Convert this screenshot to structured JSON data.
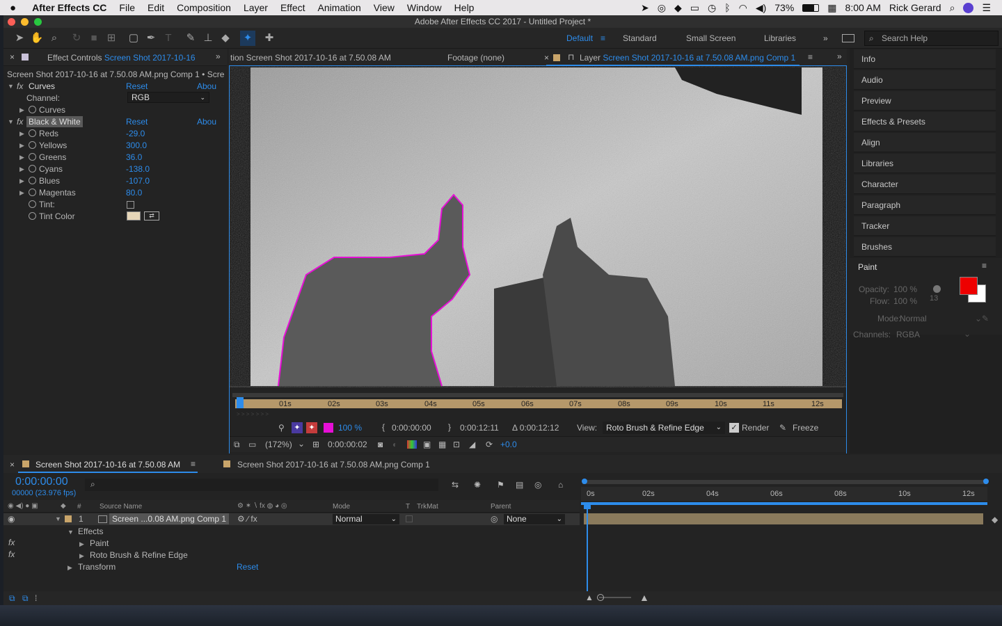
{
  "menubar": {
    "apple_icon": "apple-icon",
    "app_name": "After Effects CC",
    "items": [
      "File",
      "Edit",
      "Composition",
      "Layer",
      "Effect",
      "Animation",
      "View",
      "Window",
      "Help"
    ],
    "battery": "73%",
    "time": "8:00 AM",
    "user": "Rick Gerard"
  },
  "window": {
    "title": "Adobe After Effects CC 2017 - Untitled Project *"
  },
  "workspaces": {
    "default": "Default",
    "standard": "Standard",
    "small_screen": "Small Screen",
    "libraries": "Libraries",
    "search_placeholder": "Search Help"
  },
  "effect_controls": {
    "tab_prefix": "Effect Controls",
    "tab_source": "Screen Shot 2017-10-16",
    "header": "Screen Shot 2017-10-16 at 7.50.08 AM.png Comp 1 • Scre",
    "curves": {
      "name": "Curves",
      "reset": "Reset",
      "about": "Abou",
      "channel_label": "Channel:",
      "channel_value": "RGB",
      "curves_label": "Curves"
    },
    "bw": {
      "name": "Black & White",
      "reset": "Reset",
      "about": "Abou",
      "params": [
        {
          "label": "Reds",
          "value": "-29.0"
        },
        {
          "label": "Yellows",
          "value": "300.0"
        },
        {
          "label": "Greens",
          "value": "36.0"
        },
        {
          "label": "Cyans",
          "value": "-138.0"
        },
        {
          "label": "Blues",
          "value": "-107.0"
        },
        {
          "label": "Magentas",
          "value": "80.0"
        }
      ],
      "tint_label": "Tint:",
      "tint_color_label": "Tint Color"
    }
  },
  "viewer": {
    "tab_comp": "tion Screen Shot 2017-10-16 at 7.50.08 AM",
    "tab_footage": "Footage (none)",
    "tab_layer_prefix": "Layer",
    "tab_layer_name": "Screen Shot 2017-10-16 at 7.50.08 AM.png Comp 1",
    "ruler": [
      "01s",
      "02s",
      "03s",
      "04s",
      "05s",
      "06s",
      "07s",
      "08s",
      "09s",
      "10s",
      "11s",
      "12s"
    ],
    "ruler_start": "s",
    "opacity": "100 %",
    "in_time": "0:00:00:00",
    "out_time": "0:00:12:11",
    "duration": "Δ 0:00:12:12",
    "view_label": "View:",
    "view_value": "Roto Brush & Refine Edge",
    "render_label": "Render",
    "freeze_label": "Freeze",
    "zoom": "(172%)",
    "current_time": "0:00:00:02",
    "exposure": "+0.0",
    "paint_color": "#e60fd6"
  },
  "right_panel": {
    "items": [
      "Info",
      "Audio",
      "Preview",
      "Effects & Presets",
      "Align",
      "Libraries",
      "Character",
      "Paragraph",
      "Tracker",
      "Brushes"
    ],
    "paint": {
      "title": "Paint",
      "opacity_label": "Opacity:",
      "opacity_value": "100 %",
      "flow_label": "Flow:",
      "flow_value": "100 %",
      "brush_size": "13",
      "mode_label": "Mode:",
      "mode_value": "Normal",
      "channels_label": "Channels:",
      "channels_value": "RGBA",
      "fg_color": "#ee0000",
      "bg_color": "#ffffff"
    }
  },
  "timeline": {
    "tab1": "Screen Shot 2017-10-16 at 7.50.08 AM",
    "tab2": "Screen Shot 2017-10-16 at 7.50.08 AM.png Comp 1",
    "timecode": "0:00:00:00",
    "frames": "00000 (23.976 fps)",
    "headers": {
      "source": "Source Name",
      "mode": "Mode",
      "t": "T",
      "trkmat": "TrkMat",
      "parent": "Parent",
      "num": "#"
    },
    "layer": {
      "num": "1",
      "name": "Screen ...0.08 AM.png Comp 1",
      "mode": "Normal",
      "parent": "None"
    },
    "effects_label": "Effects",
    "paint_label": "Paint",
    "roto_label": "Roto Brush & Refine Edge",
    "transform_label": "Transform",
    "transform_reset": "Reset",
    "ruler": [
      "0s",
      "02s",
      "04s",
      "06s",
      "08s",
      "10s",
      "12s"
    ]
  }
}
